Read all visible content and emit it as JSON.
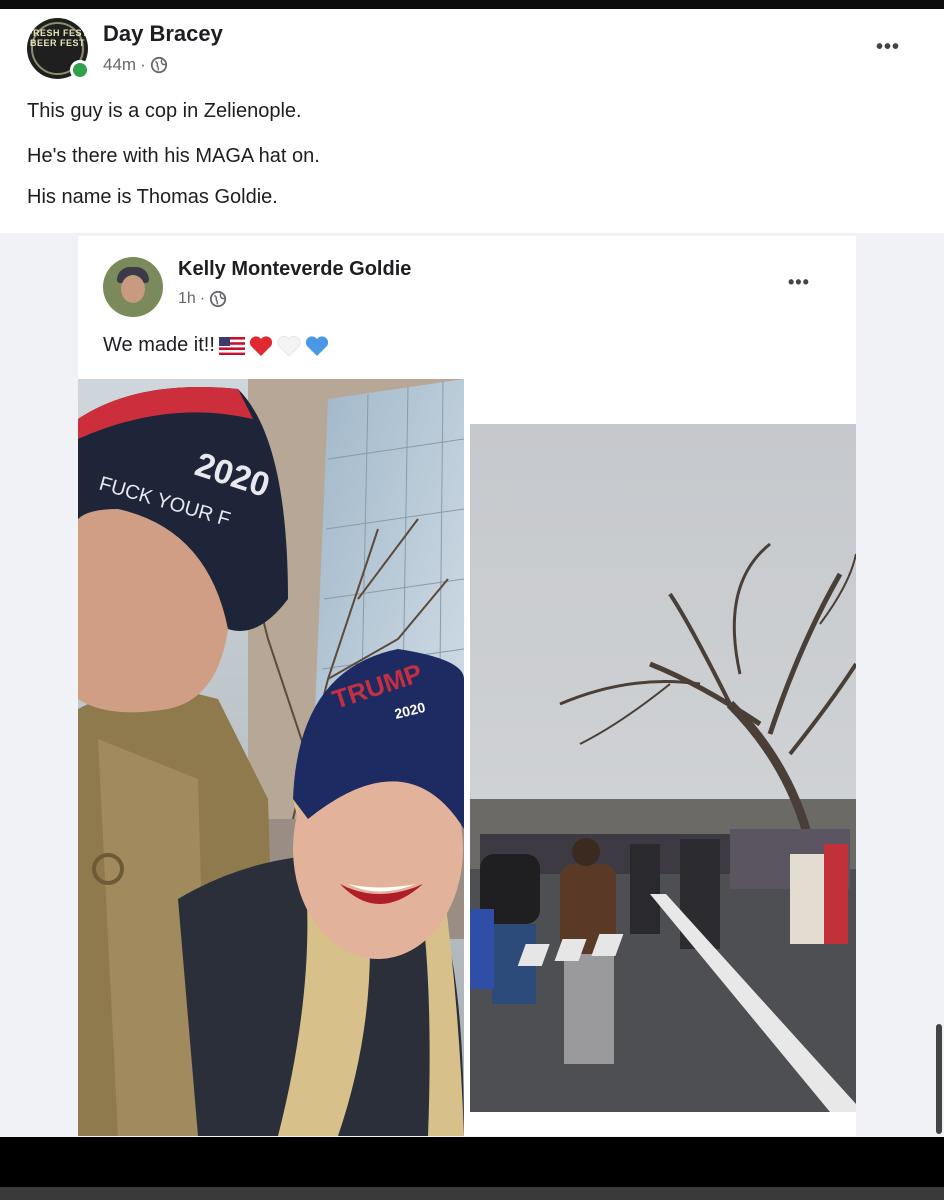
{
  "outer_post": {
    "author": "Day Bracey",
    "avatar_logo_text": "FRESH FEST BEER FEST",
    "time": "44m",
    "dot": "·",
    "lines": [
      "This guy is a cop in Zelienople.",
      "He's there with his MAGA hat on.",
      "His name is Thomas Goldie."
    ],
    "more_icon": "•••"
  },
  "shared_post": {
    "author": "Kelly Monteverde Goldie",
    "time": "1h",
    "dot": "·",
    "text": "We made it!!",
    "emojis": [
      "flag-us",
      "red-heart",
      "white-heart",
      "blue-heart"
    ],
    "more_icon": "•••",
    "photo_left": {
      "description_hat_text_1": "2020",
      "description_hat_text_2": "FUCK YOUR F",
      "description_hat_text_3": "TRUMP",
      "description_hat_text_4": "2020"
    }
  },
  "colors": {
    "online": "#31a24c",
    "meta": "#65676b",
    "text": "#1c1e21",
    "separator": "#f0f2f5"
  }
}
